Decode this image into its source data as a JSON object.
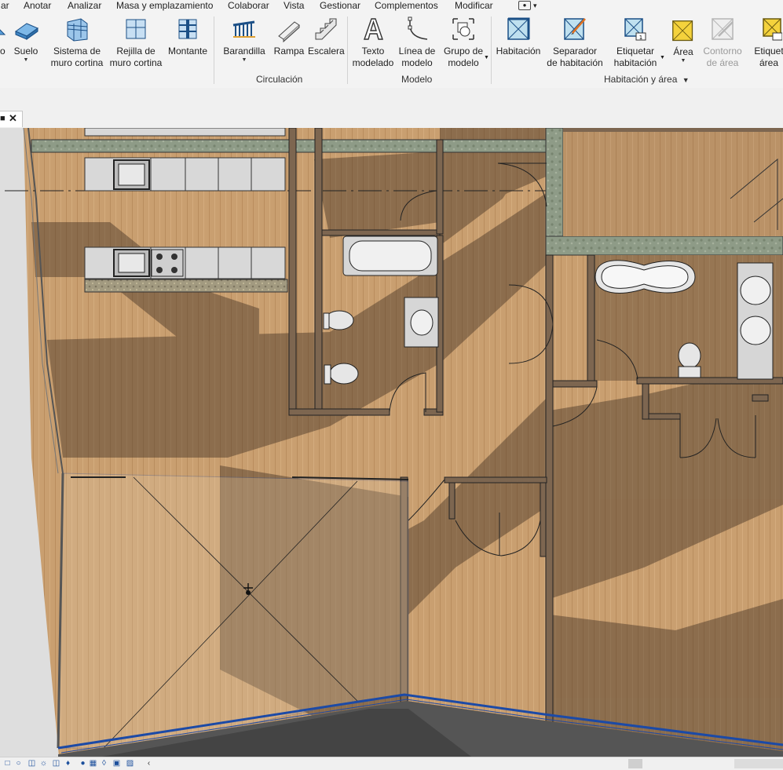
{
  "menubar": {
    "items": [
      "ar",
      "Anotar",
      "Analizar",
      "Masa y emplazamiento",
      "Colaborar",
      "Vista",
      "Gestionar",
      "Complementos",
      "Modificar"
    ]
  },
  "ribbon": {
    "buttons": {
      "fo": "o",
      "suelo": "Suelo",
      "sistema_l1": "Sistema de",
      "sistema_l2": "muro cortina",
      "rejilla_l1": "Rejilla de",
      "rejilla_l2": "muro cortina",
      "montante": "Montante",
      "barandilla": "Barandilla",
      "rampa": "Rampa",
      "escalera": "Escalera",
      "texto_l1": "Texto",
      "texto_l2": "modelado",
      "linea_l1": "Línea de",
      "linea_l2": "modelo",
      "grupo_l1": "Grupo de",
      "grupo_l2": "modelo",
      "habitacion": "Habitación",
      "separador_l1": "Separador",
      "separador_l2": "de habitación",
      "etiquetar_hab_l1": "Etiquetar",
      "etiquetar_hab_l2": "habitación",
      "area": "Área",
      "contorno_l1": "Contorno",
      "contorno_l2": "de área",
      "etiquetar_area_l1": "Etiquet",
      "etiquetar_area_l2": "área"
    },
    "panels": {
      "circulacion": "Circulación",
      "modelo": "Modelo",
      "habitacion_area": "Habitación y área"
    }
  },
  "icons": {
    "close": "close-icon",
    "status_bar": [
      "scale-icon",
      "detail-level-icon",
      "visual-style-icon",
      "sun-path-icon",
      "shadows-icon",
      "render-icon",
      "crop-view-icon",
      "show-crop-icon",
      "unlock-3d-icon",
      "temporary-hide-icon",
      "reveal-hidden-icon",
      "worksharing-icon",
      "scroll-left-icon"
    ]
  },
  "colors": {
    "ribbon_bg": "#f3f3f3",
    "floor_wood": "#c79c6a",
    "floor_dark": "#7d6650",
    "wall_hatch": "#8c9a86",
    "glass_edge": "#1c4aa6",
    "area_yellow": "#f4d23c"
  }
}
